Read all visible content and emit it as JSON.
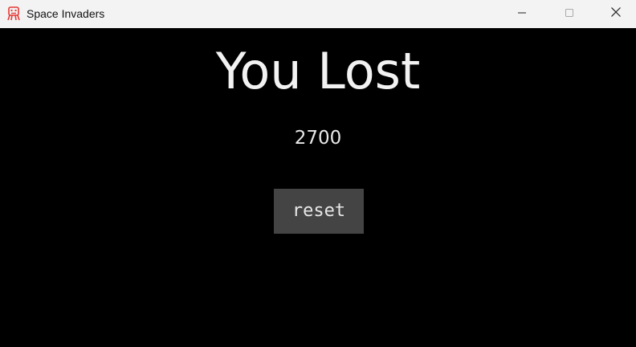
{
  "window": {
    "title": "Space Invaders",
    "icon": "space-invader-robot-icon",
    "controls": [
      "minimize-icon",
      "maximize-icon",
      "close-icon"
    ]
  },
  "game": {
    "headline": "You Lost",
    "score": "2700",
    "reset_label": "reset"
  },
  "colors": {
    "titlebar_bg": "#f3f3f3",
    "game_bg": "#000000",
    "text": "#f2f2f2",
    "button_bg": "#444444",
    "icon_accent": "#e53935"
  }
}
